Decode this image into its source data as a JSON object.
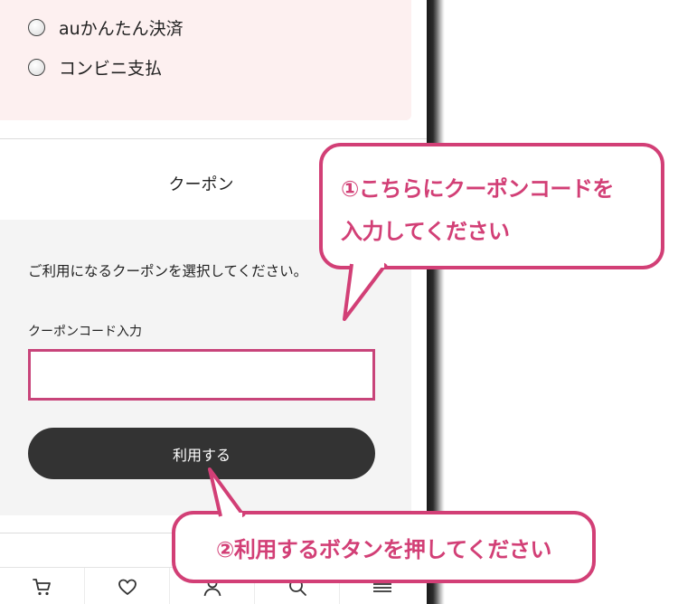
{
  "payment": {
    "options": [
      {
        "label": "auかんたん決済"
      },
      {
        "label": "コンビニ支払"
      }
    ]
  },
  "coupon": {
    "title": "クーポン",
    "description": "ご利用になるクーポンを選択してください。",
    "input_label": "クーポンコード入力",
    "input_value": "",
    "apply_label": "利用する"
  },
  "nav": {
    "items": [
      {
        "icon": "cart-icon"
      },
      {
        "icon": "heart-icon"
      },
      {
        "icon": "user-icon"
      },
      {
        "icon": "search-icon"
      },
      {
        "icon": "menu-icon"
      }
    ]
  },
  "callouts": {
    "step1_line1": "①こちらにクーポンコードを",
    "step1_line2": "入力してください",
    "step2": "②利用するボタンを押してください"
  },
  "colors": {
    "accent": "#d23f76",
    "input_border": "#c8447a",
    "button_bg": "#333333",
    "payment_bg": "#fdf0f0",
    "coupon_bg": "#f4f4f4"
  }
}
